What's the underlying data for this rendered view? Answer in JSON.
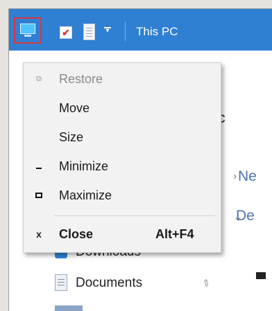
{
  "window": {
    "title": "This PC"
  },
  "quick_access": {
    "icons": [
      "computer-icon",
      "checkmark-properties-icon",
      "document-icon",
      "customize-dropdown-icon"
    ]
  },
  "system_menu": {
    "items": [
      {
        "label": "Restore",
        "icon": "restore-icon",
        "enabled": false
      },
      {
        "label": "Move",
        "icon": "",
        "enabled": true
      },
      {
        "label": "Size",
        "icon": "",
        "enabled": true
      },
      {
        "label": "Minimize",
        "icon": "minimize-icon",
        "enabled": true
      },
      {
        "label": "Maximize",
        "icon": "maximize-icon",
        "enabled": true
      },
      {
        "label": "Close",
        "icon": "close-icon",
        "enabled": true,
        "shortcut": "Alt+F4"
      }
    ]
  },
  "background": {
    "partial_c": "c",
    "nav_items": [
      "Ne",
      "De"
    ],
    "tree": [
      {
        "label": "Downloads",
        "pinned": true
      },
      {
        "label": "Documents",
        "pinned": true
      }
    ]
  },
  "colors": {
    "titlebar": "#2f7fd2",
    "highlight_border": "#d9363e",
    "menu_bg": "#f2f2f2"
  }
}
